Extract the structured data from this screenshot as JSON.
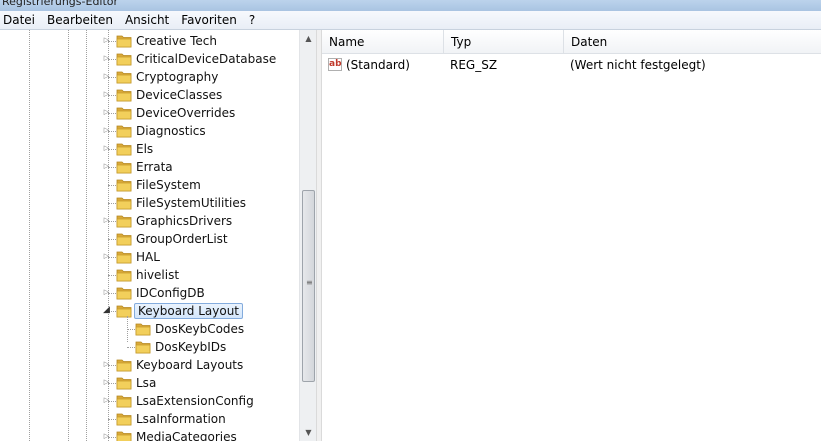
{
  "window": {
    "title": "Registrierungs-Editor"
  },
  "menu": [
    "Datei",
    "Bearbeiten",
    "Ansicht",
    "Favoriten",
    "?"
  ],
  "tree": {
    "items": [
      {
        "label": "Creative Tech",
        "level": 1,
        "expandable": true
      },
      {
        "label": "CriticalDeviceDatabase",
        "level": 1,
        "expandable": true
      },
      {
        "label": "Cryptography",
        "level": 1,
        "expandable": true
      },
      {
        "label": "DeviceClasses",
        "level": 1,
        "expandable": true
      },
      {
        "label": "DeviceOverrides",
        "level": 1,
        "expandable": true
      },
      {
        "label": "Diagnostics",
        "level": 1,
        "expandable": true
      },
      {
        "label": "Els",
        "level": 1,
        "expandable": true
      },
      {
        "label": "Errata",
        "level": 1,
        "expandable": true
      },
      {
        "label": "FileSystem",
        "level": 1,
        "expandable": false
      },
      {
        "label": "FileSystemUtilities",
        "level": 1,
        "expandable": false
      },
      {
        "label": "GraphicsDrivers",
        "level": 1,
        "expandable": true
      },
      {
        "label": "GroupOrderList",
        "level": 1,
        "expandable": false
      },
      {
        "label": "HAL",
        "level": 1,
        "expandable": true
      },
      {
        "label": "hivelist",
        "level": 1,
        "expandable": false
      },
      {
        "label": "IDConfigDB",
        "level": 1,
        "expandable": true
      },
      {
        "label": "Keyboard Layout",
        "level": 1,
        "expandable": true,
        "expanded": true,
        "selected": true
      },
      {
        "label": "DosKeybCodes",
        "level": 2,
        "expandable": false
      },
      {
        "label": "DosKeybIDs",
        "level": 2,
        "expandable": false
      },
      {
        "label": "Keyboard Layouts",
        "level": 1,
        "expandable": true
      },
      {
        "label": "Lsa",
        "level": 1,
        "expandable": true
      },
      {
        "label": "LsaExtensionConfig",
        "level": 1,
        "expandable": true
      },
      {
        "label": "LsaInformation",
        "level": 1,
        "expandable": false
      },
      {
        "label": "MediaCategories",
        "level": 1,
        "expandable": true
      }
    ]
  },
  "list": {
    "columns": [
      "Name",
      "Typ",
      "Daten"
    ],
    "rows": [
      {
        "icon": "ab",
        "name": "(Standard)",
        "type": "REG_SZ",
        "data": "(Wert nicht festgelegt)"
      }
    ]
  },
  "colors": {
    "folder": "#e8c04a",
    "selection_border": "#84acdd"
  },
  "icons": {
    "folder": "folder-icon",
    "string_value": "string-value-icon"
  }
}
